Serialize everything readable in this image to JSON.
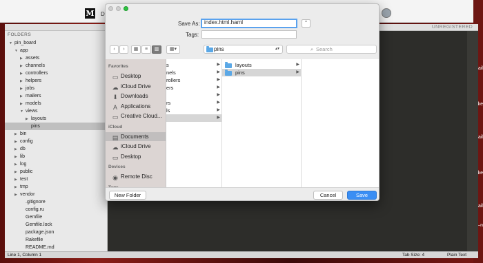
{
  "topbar": {
    "logo": "M",
    "frag": "De"
  },
  "editor": {
    "unregistered": "UNREGISTERED",
    "sidebar_header": "FOLDERS",
    "tree": [
      {
        "label": "pin_board",
        "arrow": "▼"
      },
      {
        "label": "app",
        "arrow": "▼"
      },
      {
        "label": "assets",
        "arrow": "▶"
      },
      {
        "label": "channels",
        "arrow": "▶"
      },
      {
        "label": "controllers",
        "arrow": "▶"
      },
      {
        "label": "helpers",
        "arrow": "▶"
      },
      {
        "label": "jobs",
        "arrow": "▶"
      },
      {
        "label": "mailers",
        "arrow": "▶"
      },
      {
        "label": "models",
        "arrow": "▶"
      },
      {
        "label": "views",
        "arrow": "▼"
      },
      {
        "label": "layouts",
        "arrow": "▶"
      },
      {
        "label": "pins",
        "arrow": ""
      },
      {
        "label": "bin",
        "arrow": "▶"
      },
      {
        "label": "config",
        "arrow": "▶"
      },
      {
        "label": "db",
        "arrow": "▶"
      },
      {
        "label": "lib",
        "arrow": "▶"
      },
      {
        "label": "log",
        "arrow": "▶"
      },
      {
        "label": "public",
        "arrow": "▶"
      },
      {
        "label": "test",
        "arrow": "▶"
      },
      {
        "label": "tmp",
        "arrow": "▶"
      },
      {
        "label": "vendor",
        "arrow": "▶"
      },
      {
        "label": ".gitignore",
        "arrow": ""
      },
      {
        "label": "config.ru",
        "arrow": ""
      },
      {
        "label": "Gemfile",
        "arrow": ""
      },
      {
        "label": "Gemfile.lock",
        "arrow": ""
      },
      {
        "label": "package.json",
        "arrow": ""
      },
      {
        "label": "Rakefile",
        "arrow": ""
      },
      {
        "label": "README.md",
        "arrow": ""
      }
    ],
    "status_left": "Line 1, Column 1",
    "status_tab": "Tab Size: 4",
    "status_syntax": "Plain Text"
  },
  "dialog": {
    "save_as_label": "Save As:",
    "filename": "index.html.haml",
    "tags_label": "Tags:",
    "tags_value": "",
    "expand_icon": "⌃",
    "location": "pins",
    "search_placeholder": "Search",
    "sidebar": {
      "favorites_header": "Favorites",
      "favorites": [
        {
          "label": "Desktop",
          "icon": "▭"
        },
        {
          "label": "iCloud Drive",
          "icon": "☁"
        },
        {
          "label": "Downloads",
          "icon": "⬇"
        },
        {
          "label": "Applications",
          "icon": "A"
        },
        {
          "label": "Creative Cloud...",
          "icon": "▭"
        }
      ],
      "icloud_header": "iCloud",
      "icloud": [
        {
          "label": "Documents",
          "icon": "▤"
        },
        {
          "label": "iCloud Drive",
          "icon": "☁"
        },
        {
          "label": "Desktop",
          "icon": "▭"
        }
      ],
      "devices_header": "Devices",
      "devices": [
        {
          "label": "Remote Disc",
          "icon": "◉"
        }
      ],
      "tags_header": "Tags"
    },
    "col1": [
      "s",
      "nels",
      "rollers",
      "ers",
      "",
      "rs",
      "ls",
      ""
    ],
    "col2": [
      "layouts",
      "pins"
    ],
    "new_folder": "New Folder",
    "cancel": "Cancel",
    "save": "Save"
  },
  "desk_frags": [
    "ail",
    "ke",
    "ail",
    "ke",
    "ail",
    "t–n"
  ]
}
